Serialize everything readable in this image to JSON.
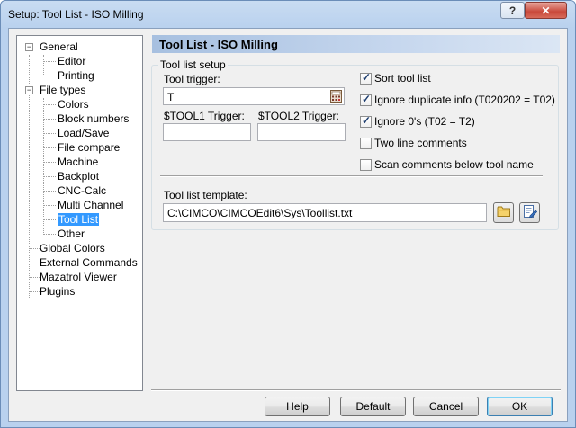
{
  "window": {
    "title": "Setup: Tool List - ISO Milling",
    "help_glyph": "?",
    "close_glyph": "✕"
  },
  "tree": {
    "items": [
      {
        "label": "General"
      },
      {
        "label": "Editor"
      },
      {
        "label": "Printing"
      },
      {
        "label": "File types"
      },
      {
        "label": "Colors"
      },
      {
        "label": "Block numbers"
      },
      {
        "label": "Load/Save"
      },
      {
        "label": "File compare"
      },
      {
        "label": "Machine"
      },
      {
        "label": "Backplot"
      },
      {
        "label": "CNC-Calc"
      },
      {
        "label": "Multi Channel"
      },
      {
        "label": "Tool List"
      },
      {
        "label": "Other"
      },
      {
        "label": "Global Colors"
      },
      {
        "label": "External Commands"
      },
      {
        "label": "Mazatrol Viewer"
      },
      {
        "label": "Plugins"
      }
    ],
    "selected": "Tool List",
    "collapse_glyph": "−"
  },
  "panel": {
    "header": "Tool List - ISO Milling",
    "group_label": "Tool list setup",
    "tool_trigger_label": "Tool trigger:",
    "tool_trigger_value": "T",
    "tool1_label": "$TOOL1 Trigger:",
    "tool1_value": "",
    "tool2_label": "$TOOL2 Trigger:",
    "tool2_value": "",
    "checkboxes": [
      {
        "label": "Sort tool list",
        "checked": true
      },
      {
        "label": "Ignore duplicate info (T020202 = T02)",
        "checked": true
      },
      {
        "label": "Ignore 0's (T02 = T2)",
        "checked": true
      },
      {
        "label": "Two line comments",
        "checked": false
      },
      {
        "label": "Scan comments below tool name",
        "checked": false
      }
    ],
    "template_label": "Tool list template:",
    "template_value": "C:\\CIMCO\\CIMCOEdit6\\Sys\\Toollist.txt"
  },
  "buttons": {
    "help": "Help",
    "default": "Default",
    "cancel": "Cancel",
    "ok": "OK"
  },
  "icons": {
    "browse": "folder-icon",
    "edit": "edit-document-icon",
    "calculator": "calculator-icon"
  }
}
